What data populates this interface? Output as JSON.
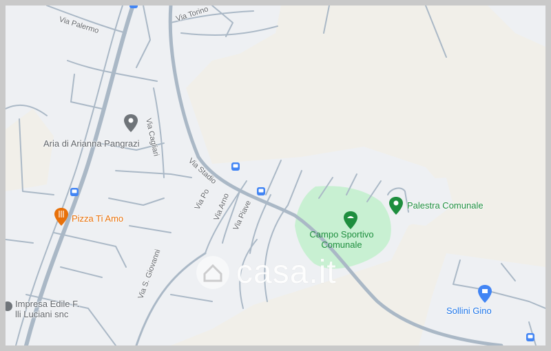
{
  "roads": {
    "via_palermo": "Via Palermo",
    "via_torino": "Via Torino",
    "via_cagliari": "Via Cagliari",
    "via_stadio": "Via Stadio",
    "via_po": "Via Po",
    "via_arno": "Via Arno",
    "via_piave": "Via Piave",
    "via_s_giovanni": "Via S. Giovanni"
  },
  "places": {
    "aria_arianna": "Aria di Arianna Pangrazi",
    "pizza": "Pizza Ti Amo",
    "palestra": "Palestra Comunale",
    "campo_line1": "Campo Sportivo",
    "campo_line2": "Comunale",
    "impresa_line1": "Impresa Edile F.",
    "impresa_line2": "lli Luciani snc",
    "sollini": "Sollini Gino"
  },
  "watermark": {
    "text": "casa.it"
  },
  "colors": {
    "land": "#f1efe9",
    "built": "#eef0f3",
    "road": "#aab8c6",
    "park": "#c8f0d2",
    "poi_grey": "#5f6368",
    "poi_orange": "#e8710a",
    "poi_green": "#1e8e3e",
    "poi_blue": "#4285f4"
  },
  "icons": {
    "aria_arianna": "map-pin-icon",
    "pizza": "restaurant-icon",
    "palestra": "map-pin-icon",
    "campo": "park-icon",
    "sollini": "shopping-icon",
    "bus": "bus-stop-icon"
  }
}
